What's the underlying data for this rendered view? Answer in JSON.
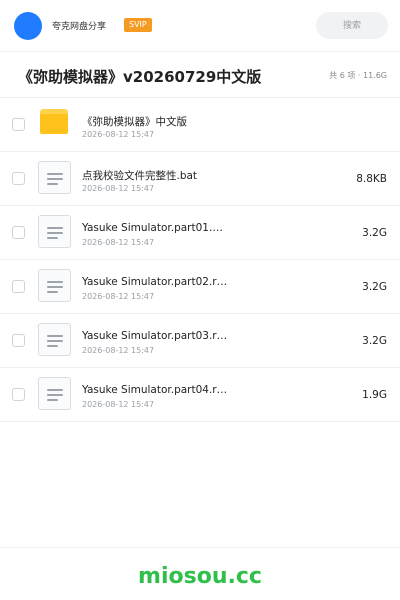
{
  "header": {
    "username": "夸克网盘分享",
    "vip_label": "SVIP",
    "search_placeholder": "搜索"
  },
  "title_bar": {
    "title": "《弥助模拟器》v20260729中文版",
    "summary": "共 6 项 · 11.6G"
  },
  "files": [
    {
      "name": "《弥助模拟器》中文版",
      "time": "2026-08-12 15:47",
      "size": "",
      "icon": "folder-icon"
    },
    {
      "name": "点我校验文件完整性.bat",
      "time": "2026-08-12 15:47",
      "size": "8.8KB",
      "icon": "file-icon"
    },
    {
      "name": "Yasuke Simulator.part01.e…",
      "time": "2026-08-12 15:47",
      "size": "3.2G",
      "icon": "file-icon"
    },
    {
      "name": "Yasuke Simulator.part02.r…",
      "time": "2026-08-12 15:47",
      "size": "3.2G",
      "icon": "file-icon"
    },
    {
      "name": "Yasuke Simulator.part03.r…",
      "time": "2026-08-12 15:47",
      "size": "3.2G",
      "icon": "file-icon"
    },
    {
      "name": "Yasuke Simulator.part04.r…",
      "time": "2026-08-12 15:47",
      "size": "1.9G",
      "icon": "file-icon"
    }
  ],
  "footer": {
    "watermark": "miosou.cc"
  },
  "colors": {
    "avatar": "#1f7bff",
    "vip_badge": "#f59b23",
    "folder": "#ffc21a",
    "watermark": "#2fbf4a"
  }
}
